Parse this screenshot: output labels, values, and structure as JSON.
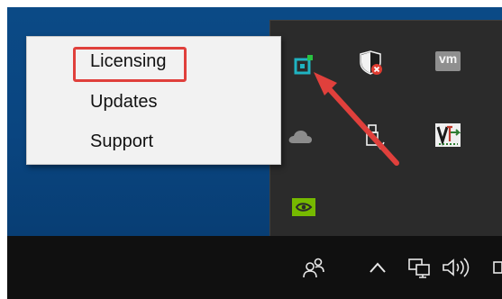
{
  "context_menu": {
    "items": [
      {
        "label": "Licensing"
      },
      {
        "label": "Updates"
      },
      {
        "label": "Support"
      }
    ]
  },
  "tray_icons": {
    "vmware_badge_text": "vm"
  },
  "colors": {
    "highlight": "#e0403c",
    "desktop": "#0a4580",
    "flyout": "#2b2b2b",
    "taskbar": "#101010",
    "app_icon_teal": "#1fb3c2",
    "nvidia_green": "#76b900"
  },
  "icons": [
    "app-tray-icon",
    "windows-defender-icon",
    "vmware-icon",
    "onedrive-icon",
    "usb-eject-icon",
    "veeam-icon",
    "nvidia-icon",
    "people-icon",
    "chevron-up-icon",
    "network-icon",
    "volume-icon"
  ]
}
